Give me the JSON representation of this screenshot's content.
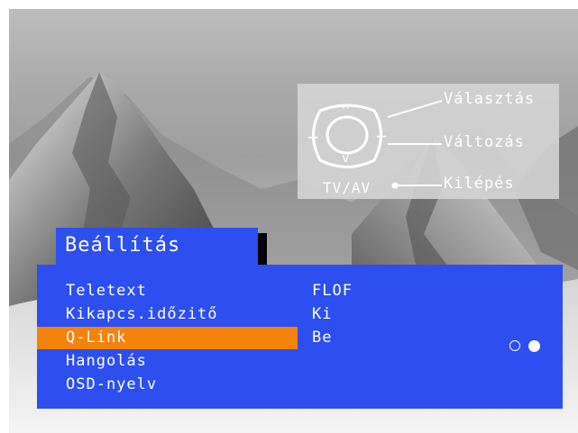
{
  "help": {
    "select_label": "Választás",
    "change_label": "Változás",
    "exit_label": "Kilépés",
    "tvav_label": "TV/AV",
    "up_symbol": "^",
    "down_symbol": "v",
    "minus_symbol": "−",
    "plus_symbol": "+"
  },
  "menu": {
    "title": "Beállítás",
    "items": [
      {
        "label": "Teletext",
        "value": "FLOF",
        "selected": false
      },
      {
        "label": "Kikapcs.időzitő",
        "value": "Ki",
        "selected": false
      },
      {
        "label": "Q-Link",
        "value": "Be",
        "selected": true
      },
      {
        "label": "Hangolás",
        "value": "",
        "selected": false
      },
      {
        "label": "OSD-nyelv",
        "value": "",
        "selected": false
      }
    ],
    "indicator": {
      "hollow": "step-1",
      "filled": "step-2"
    }
  },
  "colors": {
    "menu_bg": "#2d4ff0",
    "selected_bg": "#f5820a",
    "text": "#ffffff",
    "help_bg": "#d4d4d4"
  }
}
